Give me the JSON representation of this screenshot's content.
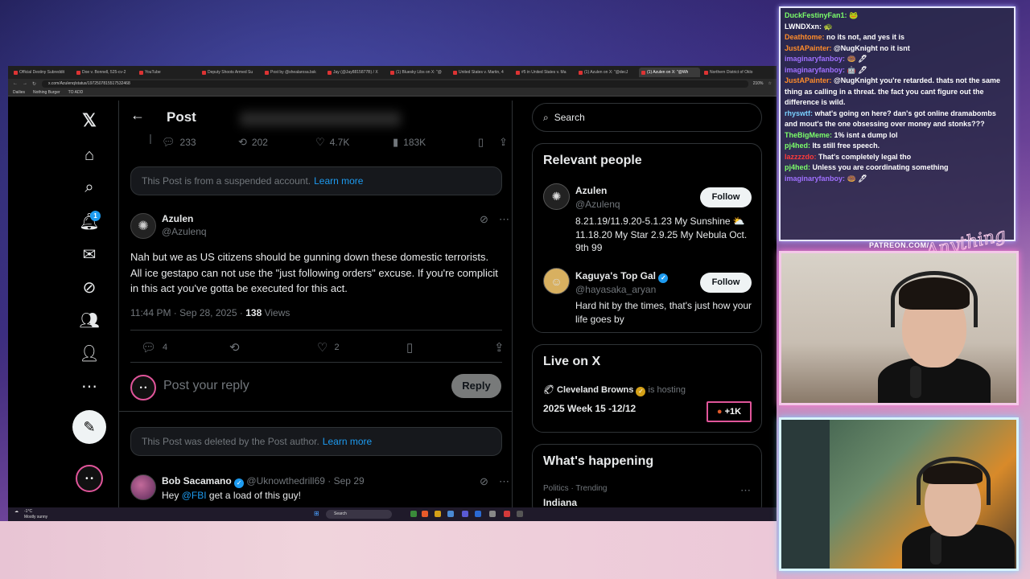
{
  "browser": {
    "tabs": [
      {
        "label": "Official Destiny Subreddit"
      },
      {
        "label": "Doe v. Bonnell, 525-cv-2"
      },
      {
        "label": "YouTube"
      },
      {
        "label": "Deputy Shoots Armed Su"
      },
      {
        "label": "Post by @shealarosa.bsk"
      },
      {
        "label": "Jay (@Jay8815877B) / X"
      },
      {
        "label": "(1) Bluesky Libs on X: \"@"
      },
      {
        "label": "United States v. Martin, 4"
      },
      {
        "label": "#5 in United States v. Ma"
      },
      {
        "label": "(1) Azulen on X: \"@decJ"
      },
      {
        "label": "(1) Azulen on X: \"@Wh"
      },
      {
        "label": "Northern District of Oklo"
      }
    ],
    "url": "x.com/Azulenq/status/1972507815517532468",
    "zoom": "210%",
    "bookmarks": [
      "Dailies",
      "Nothing Burger",
      "TO ADD"
    ]
  },
  "nav": {
    "notification_count": "1"
  },
  "main": {
    "header_title": "Post",
    "parent_stats": {
      "replies": "233",
      "reposts": "202",
      "likes": "4.7K",
      "views": "183K"
    },
    "suspended_notice": {
      "text": "This Post is from a suspended account.",
      "link": "Learn more"
    },
    "post": {
      "author_name": "Azulen",
      "author_handle": "@Azulenq",
      "text": "Nah but we as US citizens should be gunning down these domestic terrorists. All ice gestapo can not use the \"just following orders\" excuse. If you're complicit in this act you've gotta be executed for this act.",
      "time": "11:44 PM · Sep 28, 2025 ·",
      "views_count": "138",
      "views_label": "Views",
      "replies": "4",
      "likes": "2"
    },
    "reply_box": {
      "placeholder": "Post your reply",
      "button": "Reply"
    },
    "deleted_notice": {
      "text": "This Post was deleted by the Post author.",
      "link": "Learn more"
    },
    "next_post": {
      "author_name": "Bob Sacamano",
      "author_handle": "@Uknowthedrill69",
      "date": "· Sep 29",
      "text_prefix": "Hey",
      "mention": "@FBI",
      "text_suffix": "get a load of this guy!"
    }
  },
  "sidebar": {
    "search_placeholder": "Search",
    "relevant_title": "Relevant people",
    "people": [
      {
        "name": "Azulen",
        "handle": "@Azulenq",
        "bio": "8.21.19/11.9.20-5.1.23 My Sunshine ⛅ 11.18.20 My Star 2.9.25 My Nebula Oct. 9th 99",
        "button": "Follow"
      },
      {
        "name": "Kaguya's Top Gal",
        "handle": "@hayasaka_aryan",
        "bio": "Hard hit by the times, that's just how your life goes by",
        "button": "Follow"
      }
    ],
    "live_title": "Live on X",
    "live_host": "Cleveland Browns",
    "live_hosting": "is hosting",
    "live_event": "2025 Week 15 -12/12",
    "live_count": "+1K",
    "happening_title": "What's happening",
    "trend_meta": "Politics · Trending",
    "trend_name": "Indiana"
  },
  "taskbar": {
    "weather_temp": "-1°C",
    "weather_desc": "Mostly sunny",
    "search": "Search"
  },
  "chat": [
    {
      "user": "DuckFestinyFan1:",
      "text": "🐸",
      "color": "#7cff6a"
    },
    {
      "user": "LWNDXxn:",
      "text": "🐢",
      "color": "#ffffff"
    },
    {
      "user": "Deathtome:",
      "text": "no its not, and yes it is",
      "color": "#ff8c2a"
    },
    {
      "user": "JustAPainter:",
      "text": "@NugKnight no it isnt",
      "color": "#ff8c2a"
    },
    {
      "user": "imaginaryfanboy:",
      "text": "🍩 🖊",
      "color": "#a070ff"
    },
    {
      "user": "imaginaryfanboy:",
      "text": "🤖 🖊",
      "color": "#a070ff"
    },
    {
      "user": "JustAPainter:",
      "text": "@NugKnight you're retarded. thats not the same thing as calling in a threat. the fact you cant figure out the difference is wild.",
      "color": "#ff8c2a"
    },
    {
      "user": "rhyswtf:",
      "text": "what's going on here? dan's got online dramabombs and mout's the one obsessing over money and stonks???",
      "color": "#7ad0ff"
    },
    {
      "user": "TheBigMeme:",
      "text": "1% isnt a dump lol",
      "color": "#7cff6a"
    },
    {
      "user": "pj4hed:",
      "text": "Its still free speech.",
      "color": "#7cff6a"
    },
    {
      "user": "lazzzzdo:",
      "text": "That's completely legal tho",
      "color": "#ff3a3a"
    },
    {
      "user": "pj4hed:",
      "text": "Unless you are coordinating something",
      "color": "#7cff6a"
    },
    {
      "user": "imaginaryfanboy:",
      "text": "🍩 🖊",
      "color": "#a070ff"
    }
  ],
  "overlay": {
    "patreon": "PATREON.COM/"
  }
}
